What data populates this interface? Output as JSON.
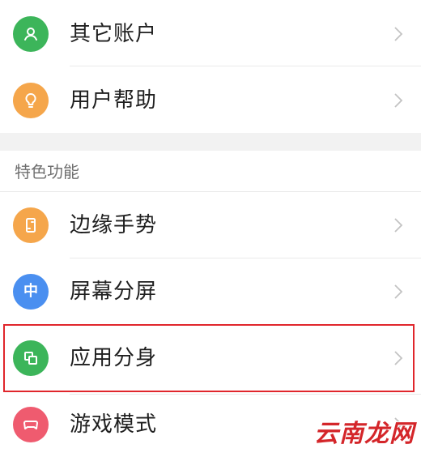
{
  "colors": {
    "green": "#3cb55a",
    "orange": "#f5a64b",
    "blue": "#4a8ff0",
    "pink": "#ef5b6f",
    "highlight_border": "#e0262c",
    "watermark": "#d4262a"
  },
  "top_items": [
    {
      "label": "其它账户",
      "icon": "user-icon",
      "color": "#3cb55a"
    },
    {
      "label": "用户帮助",
      "icon": "lightbulb-icon",
      "color": "#f5a64b"
    }
  ],
  "section": {
    "title": "特色功能"
  },
  "feature_items": [
    {
      "label": "边缘手势",
      "icon": "phone-edge-icon",
      "color": "#f5a64b"
    },
    {
      "label": "屏幕分屏",
      "icon": "split-screen-icon",
      "color": "#4a8ff0",
      "icon_text": "中"
    },
    {
      "label": "应用分身",
      "icon": "app-clone-icon",
      "color": "#3cb55a"
    },
    {
      "label": "游戏模式",
      "icon": "gamepad-icon",
      "color": "#ef5b6f"
    }
  ],
  "watermark": "云南龙网"
}
